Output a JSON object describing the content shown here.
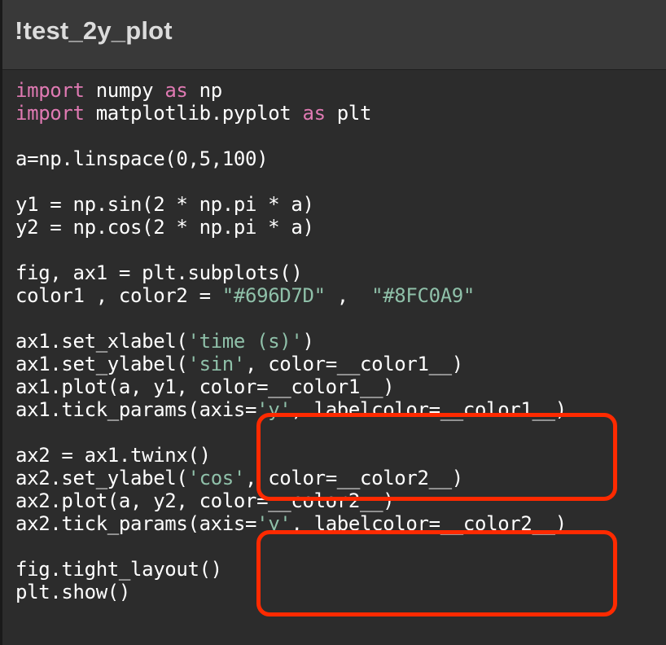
{
  "window": {
    "title": "!test_2y_plot"
  },
  "code": {
    "lines": [
      [
        [
          "kw",
          "import"
        ],
        [
          "plain",
          " numpy "
        ],
        [
          "kw",
          "as"
        ],
        [
          "plain",
          " np"
        ]
      ],
      [
        [
          "kw",
          "import"
        ],
        [
          "plain",
          " matplotlib.pyplot "
        ],
        [
          "kw",
          "as"
        ],
        [
          "plain",
          " plt"
        ]
      ],
      [],
      [
        [
          "plain",
          "a=np.linspace(0,5,100)"
        ]
      ],
      [],
      [
        [
          "plain",
          "y1 = np.sin(2 * np.pi * a)"
        ]
      ],
      [
        [
          "plain",
          "y2 = np.cos(2 * np.pi * a)"
        ]
      ],
      [],
      [
        [
          "plain",
          "fig, ax1 = plt.subplots()"
        ]
      ],
      [
        [
          "plain",
          "color1 , color2 = "
        ],
        [
          "str",
          "\"#696D7D\""
        ],
        [
          "plain",
          " ,  "
        ],
        [
          "str",
          "\"#8FC0A9\""
        ]
      ],
      [],
      [
        [
          "plain",
          "ax1.set_xlabel("
        ],
        [
          "str",
          "'time (s)'"
        ],
        [
          "plain",
          ")"
        ]
      ],
      [
        [
          "plain",
          "ax1.set_ylabel("
        ],
        [
          "str",
          "'sin'"
        ],
        [
          "plain",
          ", color=__color1__)"
        ]
      ],
      [
        [
          "plain",
          "ax1.plot(a, y1, color=__color1__)"
        ]
      ],
      [
        [
          "plain",
          "ax1.tick_params(axis="
        ],
        [
          "str",
          "'y'"
        ],
        [
          "plain",
          ", labelcolor=__color1__)"
        ]
      ],
      [],
      [
        [
          "plain",
          "ax2 = ax1.twinx()"
        ]
      ],
      [
        [
          "plain",
          "ax2.set_ylabel("
        ],
        [
          "str",
          "'cos'"
        ],
        [
          "plain",
          ", color=__color2__)"
        ]
      ],
      [
        [
          "plain",
          "ax2.plot(a, y2, color=__color2__)"
        ]
      ],
      [
        [
          "plain",
          "ax2.tick_params(axis="
        ],
        [
          "str",
          "'y'"
        ],
        [
          "plain",
          ", labelcolor=__color2__)"
        ]
      ],
      [],
      [
        [
          "plain",
          "fig.tight_layout()"
        ]
      ],
      [
        [
          "plain",
          "plt.show()"
        ]
      ]
    ]
  },
  "colors": {
    "keyword": "#e07ab3",
    "string": "#8fc0a9",
    "text": "#ffffff",
    "highlight": "#ff2a00"
  }
}
